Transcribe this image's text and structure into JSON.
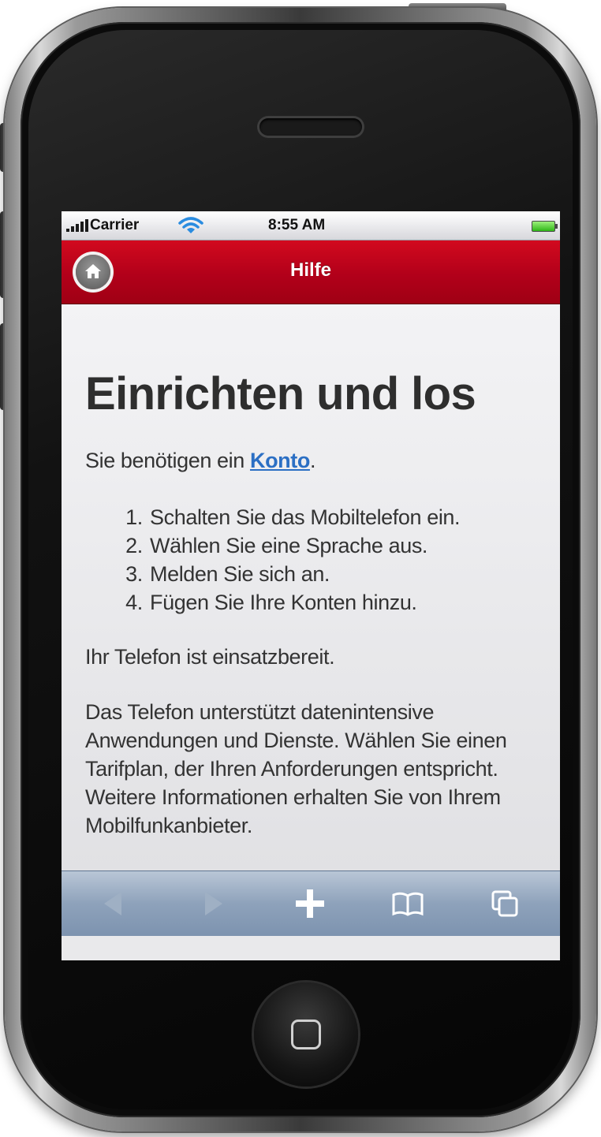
{
  "status_bar": {
    "carrier": "Carrier",
    "time": "8:55 AM"
  },
  "header": {
    "title": "Hilfe"
  },
  "content": {
    "heading": "Einrichten und los",
    "intro_prefix": "Sie benötigen ein ",
    "intro_link": "Konto",
    "intro_suffix": ".",
    "steps": [
      "Schalten Sie das Mobiltelefon ein.",
      "Wählen Sie eine Sprache aus.",
      "Melden Sie sich an.",
      "Fügen Sie Ihre Konten hinzu."
    ],
    "ready": "Ihr Telefon ist einsatzbereit.",
    "paragraph": "Das Telefon unterstützt datenintensive Anwendungen und Dienste. Wählen Sie einen Tarifplan, der Ihren Anforderungen entspricht. Weitere Informationen erhalten Sie von Ihrem Mobilfunkanbieter."
  },
  "toolbar": {
    "buttons": [
      "back-icon",
      "forward-icon",
      "add-icon",
      "bookmarks-icon",
      "pages-icon"
    ]
  },
  "colors": {
    "header_red": "#b2001a",
    "link_blue": "#2b6fc4",
    "toolbar_blue": "#8ea2bb"
  }
}
